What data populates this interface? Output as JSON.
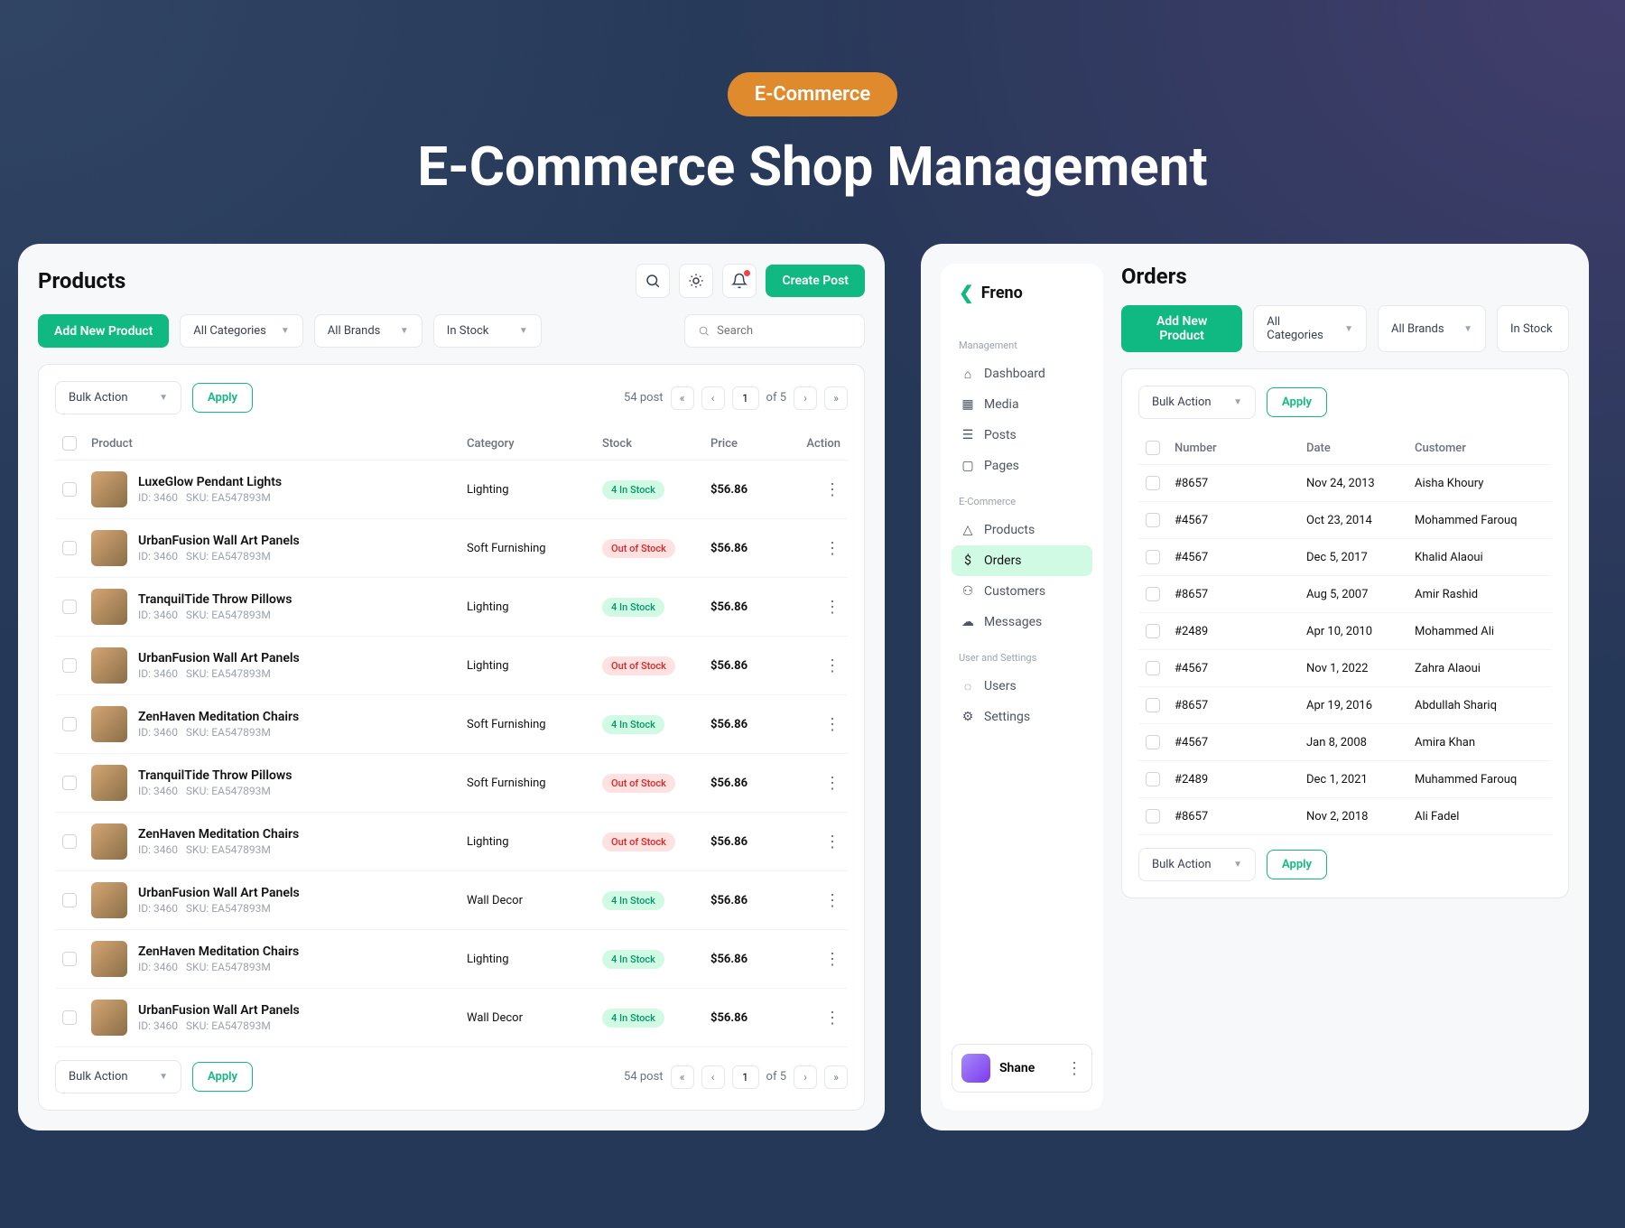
{
  "hero": {
    "pill": "E-Commerce",
    "title": "E-Commerce Shop Management"
  },
  "left": {
    "title": "Products",
    "create_post": "Create Post",
    "add_new": "Add New Product",
    "filters": {
      "categories": "All Categories",
      "brands": "All Brands",
      "stock": "In Stock"
    },
    "search_placeholder": "Search",
    "bulk_label": "Bulk Action",
    "apply": "Apply",
    "post_count": "54 post",
    "page_current": "1",
    "page_of": "of 5",
    "columns": {
      "product": "Product",
      "category": "Category",
      "stock": "Stock",
      "price": "Price",
      "action": "Action"
    },
    "rows": [
      {
        "name": "LuxeGlow Pendant Lights",
        "id": "ID: 3460",
        "sku": "SKU: EA547893M",
        "category": "Lighting",
        "stock": "4 In Stock",
        "stock_state": "in",
        "price": "$56.86"
      },
      {
        "name": "UrbanFusion Wall Art Panels",
        "id": "ID: 3460",
        "sku": "SKU: EA547893M",
        "category": "Soft Furnishing",
        "stock": "Out of Stock",
        "stock_state": "out",
        "price": "$56.86"
      },
      {
        "name": "TranquilTide Throw Pillows",
        "id": "ID: 3460",
        "sku": "SKU: EA547893M",
        "category": "Lighting",
        "stock": "4 In Stock",
        "stock_state": "in",
        "price": "$56.86"
      },
      {
        "name": "UrbanFusion Wall Art Panels",
        "id": "ID: 3460",
        "sku": "SKU: EA547893M",
        "category": "Lighting",
        "stock": "Out of Stock",
        "stock_state": "out",
        "price": "$56.86"
      },
      {
        "name": "ZenHaven Meditation Chairs",
        "id": "ID: 3460",
        "sku": "SKU: EA547893M",
        "category": "Soft Furnishing",
        "stock": "4 In Stock",
        "stock_state": "in",
        "price": "$56.86"
      },
      {
        "name": "TranquilTide Throw Pillows",
        "id": "ID: 3460",
        "sku": "SKU: EA547893M",
        "category": "Soft Furnishing",
        "stock": "Out of Stock",
        "stock_state": "out",
        "price": "$56.86"
      },
      {
        "name": "ZenHaven Meditation Chairs",
        "id": "ID: 3460",
        "sku": "SKU: EA547893M",
        "category": "Lighting",
        "stock": "Out of Stock",
        "stock_state": "out",
        "price": "$56.86"
      },
      {
        "name": "UrbanFusion Wall Art Panels",
        "id": "ID: 3460",
        "sku": "SKU: EA547893M",
        "category": "Wall Decor",
        "stock": "4 In Stock",
        "stock_state": "in",
        "price": "$56.86"
      },
      {
        "name": "ZenHaven Meditation Chairs",
        "id": "ID: 3460",
        "sku": "SKU: EA547893M",
        "category": "Lighting",
        "stock": "4 In Stock",
        "stock_state": "in",
        "price": "$56.86"
      },
      {
        "name": "UrbanFusion Wall Art Panels",
        "id": "ID: 3460",
        "sku": "SKU: EA547893M",
        "category": "Wall Decor",
        "stock": "4 In Stock",
        "stock_state": "in",
        "price": "$56.86"
      }
    ]
  },
  "sidebar": {
    "brand": "Freno",
    "sections": {
      "management": "Management",
      "ecommerce": "E-Commerce",
      "user_settings": "User and Settings"
    },
    "items": {
      "dashboard": "Dashboard",
      "media": "Media",
      "posts": "Posts",
      "pages": "Pages",
      "products": "Products",
      "orders": "Orders",
      "customers": "Customers",
      "messages": "Messages",
      "users": "Users",
      "settings": "Settings"
    },
    "user": "Shane"
  },
  "right": {
    "title": "Orders",
    "add_new": "Add New Product",
    "filters": {
      "categories": "All Categories",
      "brands": "All Brands",
      "stock": "In Stock"
    },
    "bulk_label": "Bulk Action",
    "apply": "Apply",
    "columns": {
      "number": "Number",
      "date": "Date",
      "customer": "Customer"
    },
    "rows": [
      {
        "number": "#8657",
        "date": "Nov 24, 2013",
        "customer": "Aisha Khoury"
      },
      {
        "number": "#4567",
        "date": "Oct 23, 2014",
        "customer": "Mohammed Farouq"
      },
      {
        "number": "#4567",
        "date": "Dec 5, 2017",
        "customer": "Khalid Alaoui"
      },
      {
        "number": "#8657",
        "date": "Aug 5, 2007",
        "customer": "Amir Rashid"
      },
      {
        "number": "#2489",
        "date": "Apr 10, 2010",
        "customer": "Mohammed Ali"
      },
      {
        "number": "#4567",
        "date": "Nov 1, 2022",
        "customer": "Zahra Alaoui"
      },
      {
        "number": "#8657",
        "date": "Apr 19, 2016",
        "customer": "Abdullah Shariq"
      },
      {
        "number": "#4567",
        "date": "Jan 8, 2008",
        "customer": "Amira Khan"
      },
      {
        "number": "#2489",
        "date": "Dec 1, 2021",
        "customer": "Muhammed Farouq"
      },
      {
        "number": "#8657",
        "date": "Nov 2, 2018",
        "customer": "Ali Fadel"
      }
    ]
  }
}
